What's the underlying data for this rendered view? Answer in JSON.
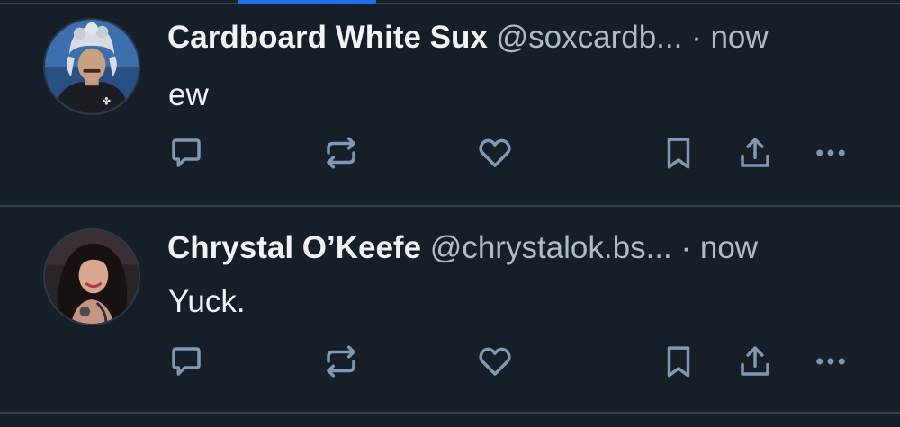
{
  "colors": {
    "background": "#161e27",
    "divider": "#2e4052",
    "accent": "#1d6ff0",
    "text_primary": "#f1f3f5",
    "text_secondary": "#aebbc9",
    "icon": "#7f98b3"
  },
  "posts": [
    {
      "display_name": "Cardboard White Sux",
      "handle": "@soxcardb...",
      "separator": "·",
      "timestamp": "now",
      "text": "ew",
      "avatar_icon": "user-avatar-fur-hat"
    },
    {
      "display_name": "Chrystal O’Keefe",
      "handle": "@chrystalok.bs...",
      "separator": "·",
      "timestamp": "now",
      "text": "Yuck.",
      "avatar_icon": "user-avatar-portrait"
    }
  ],
  "actions": [
    {
      "icon": "reply-icon"
    },
    {
      "icon": "repost-icon"
    },
    {
      "icon": "like-heart-icon"
    },
    {
      "icon": "bookmark-icon"
    },
    {
      "icon": "share-icon"
    },
    {
      "icon": "more-options-icon"
    }
  ]
}
